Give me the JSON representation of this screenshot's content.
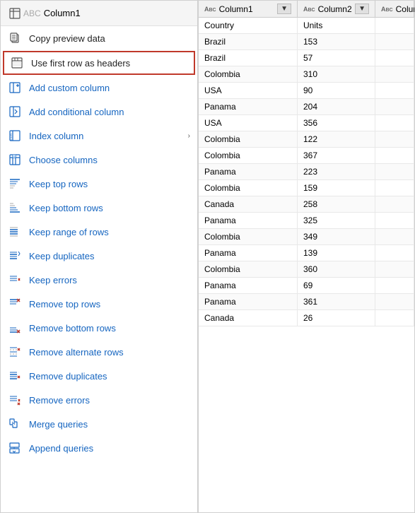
{
  "menu": {
    "header": {
      "icon": "table-icon",
      "label": "Column1"
    },
    "items": [
      {
        "id": "copy-preview",
        "label": "Copy preview data",
        "icon": "copy-icon",
        "hasArrow": false,
        "highlighted": false,
        "colorScheme": "normal"
      },
      {
        "id": "use-first-row",
        "label": "Use first row as headers",
        "icon": "first-row-icon",
        "hasArrow": false,
        "highlighted": true,
        "colorScheme": "normal"
      },
      {
        "id": "add-custom-col",
        "label": "Add custom column",
        "icon": "custom-col-icon",
        "hasArrow": false,
        "highlighted": false,
        "colorScheme": "blue"
      },
      {
        "id": "add-conditional-col",
        "label": "Add conditional column",
        "icon": "conditional-col-icon",
        "hasArrow": false,
        "highlighted": false,
        "colorScheme": "blue"
      },
      {
        "id": "index-column",
        "label": "Index column",
        "icon": "index-col-icon",
        "hasArrow": true,
        "highlighted": false,
        "colorScheme": "blue"
      },
      {
        "id": "choose-columns",
        "label": "Choose columns",
        "icon": "choose-col-icon",
        "hasArrow": false,
        "highlighted": false,
        "colorScheme": "blue"
      },
      {
        "id": "keep-top-rows",
        "label": "Keep top rows",
        "icon": "keep-top-icon",
        "hasArrow": false,
        "highlighted": false,
        "colorScheme": "blue"
      },
      {
        "id": "keep-bottom-rows",
        "label": "Keep bottom rows",
        "icon": "keep-bottom-icon",
        "hasArrow": false,
        "highlighted": false,
        "colorScheme": "blue"
      },
      {
        "id": "keep-range-rows",
        "label": "Keep range of rows",
        "icon": "keep-range-icon",
        "hasArrow": false,
        "highlighted": false,
        "colorScheme": "blue"
      },
      {
        "id": "keep-duplicates",
        "label": "Keep duplicates",
        "icon": "keep-dup-icon",
        "hasArrow": false,
        "highlighted": false,
        "colorScheme": "blue"
      },
      {
        "id": "keep-errors",
        "label": "Keep errors",
        "icon": "keep-err-icon",
        "hasArrow": false,
        "highlighted": false,
        "colorScheme": "blue"
      },
      {
        "id": "remove-top-rows",
        "label": "Remove top rows",
        "icon": "remove-top-icon",
        "hasArrow": false,
        "highlighted": false,
        "colorScheme": "red"
      },
      {
        "id": "remove-bottom-rows",
        "label": "Remove bottom rows",
        "icon": "remove-bottom-icon",
        "hasArrow": false,
        "highlighted": false,
        "colorScheme": "red"
      },
      {
        "id": "remove-alternate-rows",
        "label": "Remove alternate rows",
        "icon": "remove-alt-icon",
        "hasArrow": false,
        "highlighted": false,
        "colorScheme": "red"
      },
      {
        "id": "remove-duplicates",
        "label": "Remove duplicates",
        "icon": "remove-dup-icon",
        "hasArrow": false,
        "highlighted": false,
        "colorScheme": "red"
      },
      {
        "id": "remove-errors",
        "label": "Remove errors",
        "icon": "remove-err-icon",
        "hasArrow": false,
        "highlighted": false,
        "colorScheme": "red"
      },
      {
        "id": "merge-queries",
        "label": "Merge queries",
        "icon": "merge-icon",
        "hasArrow": false,
        "highlighted": false,
        "colorScheme": "blue"
      },
      {
        "id": "append-queries",
        "label": "Append queries",
        "icon": "append-icon",
        "hasArrow": false,
        "highlighted": false,
        "colorScheme": "blue"
      }
    ]
  },
  "table": {
    "columns": [
      {
        "id": "col1",
        "name": "Column1",
        "typeIcon": "abc-icon"
      },
      {
        "id": "col2",
        "name": "Column2",
        "typeIcon": "abc-icon"
      },
      {
        "id": "col3",
        "name": "Colum",
        "typeIcon": "abc-icon"
      }
    ],
    "rows": [
      {
        "col1": "Country",
        "col2": "Units",
        "col3": ""
      },
      {
        "col1": "Brazil",
        "col2": "153",
        "col3": ""
      },
      {
        "col1": "Brazil",
        "col2": "57",
        "col3": ""
      },
      {
        "col1": "Colombia",
        "col2": "310",
        "col3": ""
      },
      {
        "col1": "USA",
        "col2": "90",
        "col3": ""
      },
      {
        "col1": "Panama",
        "col2": "204",
        "col3": ""
      },
      {
        "col1": "USA",
        "col2": "356",
        "col3": ""
      },
      {
        "col1": "Colombia",
        "col2": "122",
        "col3": ""
      },
      {
        "col1": "Colombia",
        "col2": "367",
        "col3": ""
      },
      {
        "col1": "Panama",
        "col2": "223",
        "col3": ""
      },
      {
        "col1": "Colombia",
        "col2": "159",
        "col3": ""
      },
      {
        "col1": "Canada",
        "col2": "258",
        "col3": ""
      },
      {
        "col1": "Panama",
        "col2": "325",
        "col3": ""
      },
      {
        "col1": "Colombia",
        "col2": "349",
        "col3": ""
      },
      {
        "col1": "Panama",
        "col2": "139",
        "col3": ""
      },
      {
        "col1": "Colombia",
        "col2": "360",
        "col3": ""
      },
      {
        "col1": "Panama",
        "col2": "69",
        "col3": ""
      },
      {
        "col1": "Panama",
        "col2": "361",
        "col3": ""
      },
      {
        "col1": "Canada",
        "col2": "26",
        "col3": ""
      }
    ]
  },
  "icons": {
    "table": "⊞",
    "abc": "ABC",
    "copy": "📋",
    "arrow": "›"
  }
}
